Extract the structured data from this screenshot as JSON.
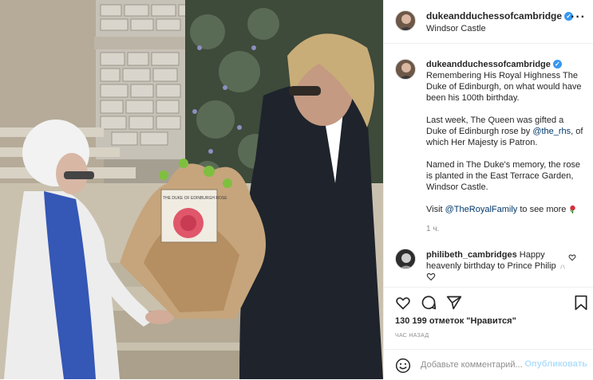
{
  "post": {
    "username": "dukeandduchessofcambridge",
    "location": "Windsor Castle",
    "caption": {
      "line1": "Remembering His Royal Highness The Duke of Edinburgh, on what would have been his 100th birthday.",
      "p2_before": "Last week, The Queen was gifted a Duke of Edinburgh rose by ",
      "p2_mention": "@the_rhs",
      "p2_after": ", of which Her Majesty is Patron.",
      "p3": "Named in The Duke's memory, the rose is planted in the East Terrace Garden, Windsor Castle.",
      "p4_before": "Visit ",
      "p4_mention": "@TheRoyalFamily",
      "p4_after": " to see more"
    },
    "caption_time": "1 ч.",
    "comment": {
      "username": "philibeth_cambridges",
      "text": "Happy heavenly birthday to Prince Philip"
    },
    "likes": "130 199 отметок \"Нравится\"",
    "time_ago": "ЧАС НАЗАД",
    "add_comment_placeholder": "Добавьте комментарий...",
    "publish_label": "Опубликовать",
    "photo_card_text": "THE DUKE OF EDINBURGH ROSE"
  },
  "icons": {
    "more": "more-options-icon",
    "like": "heart-icon",
    "comment": "comment-icon",
    "share": "share-icon",
    "save": "bookmark-icon",
    "emoji": "emoji-icon",
    "verified": "verified-badge-icon"
  },
  "colors": {
    "verified": "#3897f0",
    "mention": "#00376b",
    "publish_disabled": "#b2dffc",
    "muted": "#8e8e8e"
  }
}
